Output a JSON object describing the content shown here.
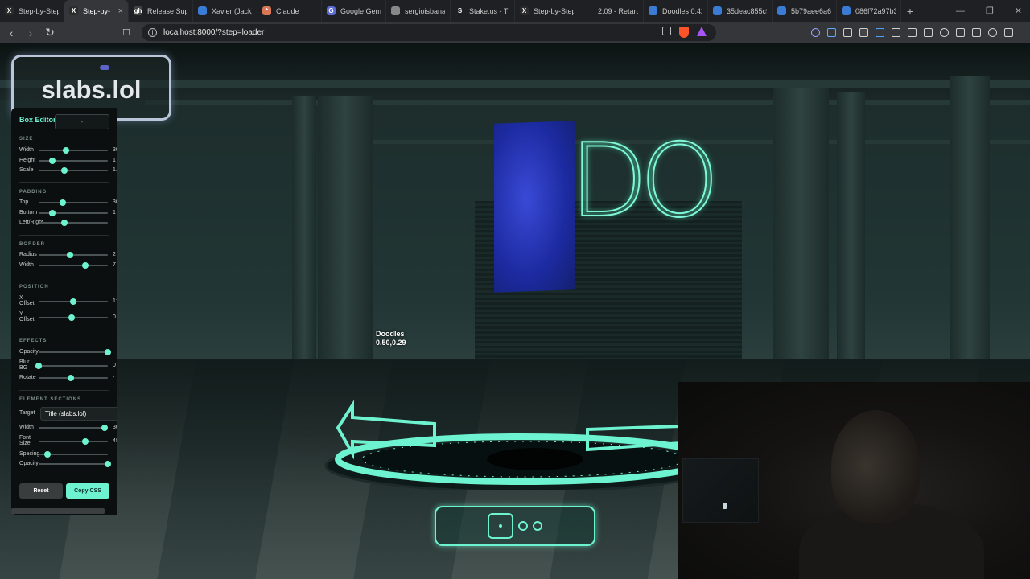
{
  "browser": {
    "tabs": [
      {
        "label": "Step-by-Step",
        "fav": "X",
        "color": "#2b2b2b"
      },
      {
        "label": "Step-by-",
        "fav": "X",
        "color": "#2b2b2b",
        "active": true
      },
      {
        "label": "Release Supe",
        "fav": "gh",
        "color": "#444"
      },
      {
        "label": "Xavier (Jack)",
        "fav": "",
        "color": "#3a7bd5"
      },
      {
        "label": "Claude",
        "fav": "*",
        "color": "#d97757"
      },
      {
        "label": "Google Gemi",
        "fav": "G",
        "color": "#5b6bd6"
      },
      {
        "label": "sergioisbana",
        "fav": "",
        "color": "#888"
      },
      {
        "label": "Stake.us - The",
        "fav": "S",
        "color": "#1f2023"
      },
      {
        "label": "Step-by-Step",
        "fav": "X",
        "color": "#2b2b2b"
      },
      {
        "label": "2.09 - Retard",
        "fav": "",
        "color": "#1f2023"
      },
      {
        "label": "Doodles 0.42",
        "fav": "",
        "color": "#3a7bd5"
      },
      {
        "label": "35deac855c9",
        "fav": "",
        "color": "#3a7bd5"
      },
      {
        "label": "5b79aee6a63",
        "fav": "",
        "color": "#3a7bd5"
      },
      {
        "label": "086f72a97b3",
        "fav": "",
        "color": "#3a7bd5"
      }
    ],
    "new_tab": "+",
    "url": "localhost:8000/?step=loader"
  },
  "scene": {
    "title": "slabs.lol",
    "big_text": "DO",
    "doodle_name": "Doodles",
    "doodle_coords": "0.50,0.29"
  },
  "editor": {
    "header": "Box Editor",
    "header_input": "-",
    "sections": {
      "size": "SIZE",
      "padding": "PADDING",
      "border": "BORDER",
      "position": "POSITION",
      "effects": "EFFECTS",
      "element": "ELEMENT SECTIONS"
    },
    "rows": {
      "width": {
        "label": "Width",
        "value": "30",
        "level": 0.4
      },
      "height": {
        "label": "Height",
        "value": "1",
        "level": 0.2
      },
      "scale": {
        "label": "Scale",
        "value": "1.",
        "level": 0.37
      },
      "top": {
        "label": "Top",
        "value": "30",
        "level": 0.35
      },
      "bottom": {
        "label": "Bottom",
        "value": "1",
        "level": 0.2
      },
      "leftright": {
        "label": "Left/Right",
        "value": "",
        "level": 0.37
      },
      "radius": {
        "label": "Radius",
        "value": "2",
        "level": 0.45
      },
      "bwidth": {
        "label": "Width",
        "value": "7",
        "level": 0.67
      },
      "xoff": {
        "label": "X Offset",
        "value": "1:",
        "level": 0.5
      },
      "yoff": {
        "label": "Y Offset",
        "value": "0",
        "level": 0.48
      },
      "opacity": {
        "label": "Opacity",
        "value": "",
        "level": 1.0
      },
      "blur": {
        "label": "Blur BG",
        "value": "0",
        "level": 0.0
      },
      "rotate": {
        "label": "Rotate",
        "value": "-",
        "level": 0.47
      },
      "ewidth": {
        "label": "Width",
        "value": "30",
        "level": 0.95
      },
      "fontsize": {
        "label": "Font Size",
        "value": "48",
        "level": 0.67
      },
      "spacing": {
        "label": "Spacing",
        "value": "",
        "level": 0.13
      },
      "eopacity": {
        "label": "Opacity",
        "value": "",
        "level": 1.0
      }
    },
    "target_label": "Target",
    "target_value": "Title (slabs.lol)",
    "reset_label": "Reset",
    "copy_label": "Copy CSS"
  },
  "colors": {
    "accent": "#6ef3d0",
    "cardBlue": "#2a39c4"
  }
}
